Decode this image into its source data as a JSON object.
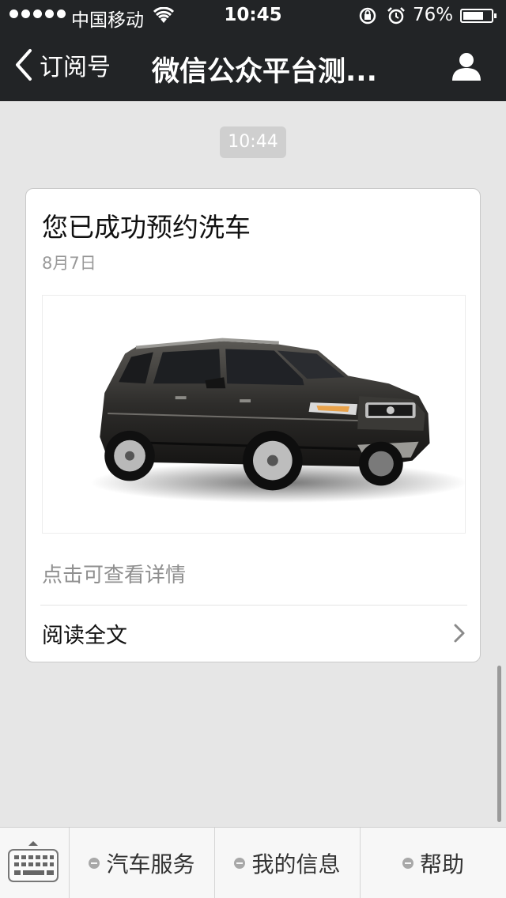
{
  "status_bar": {
    "carrier": "中国移动",
    "time": "10:45",
    "battery": "76%",
    "battery_level": 0.76
  },
  "nav": {
    "back_label": "订阅号",
    "title": "微信公众平台测..."
  },
  "chat": {
    "timestamp": "10:44",
    "card": {
      "title": "您已成功预约洗车",
      "date": "8月7日",
      "image": "car-photo",
      "description": "点击可查看详情",
      "read_more": "阅读全文"
    }
  },
  "tab_bar": {
    "items": [
      {
        "label": "汽车服务"
      },
      {
        "label": "我的信息"
      },
      {
        "label": "帮助"
      }
    ]
  },
  "colors": {
    "nav_bg": "#222426",
    "chat_bg": "#e6e6e6",
    "timestamp_bg": "#cfcfcf"
  }
}
